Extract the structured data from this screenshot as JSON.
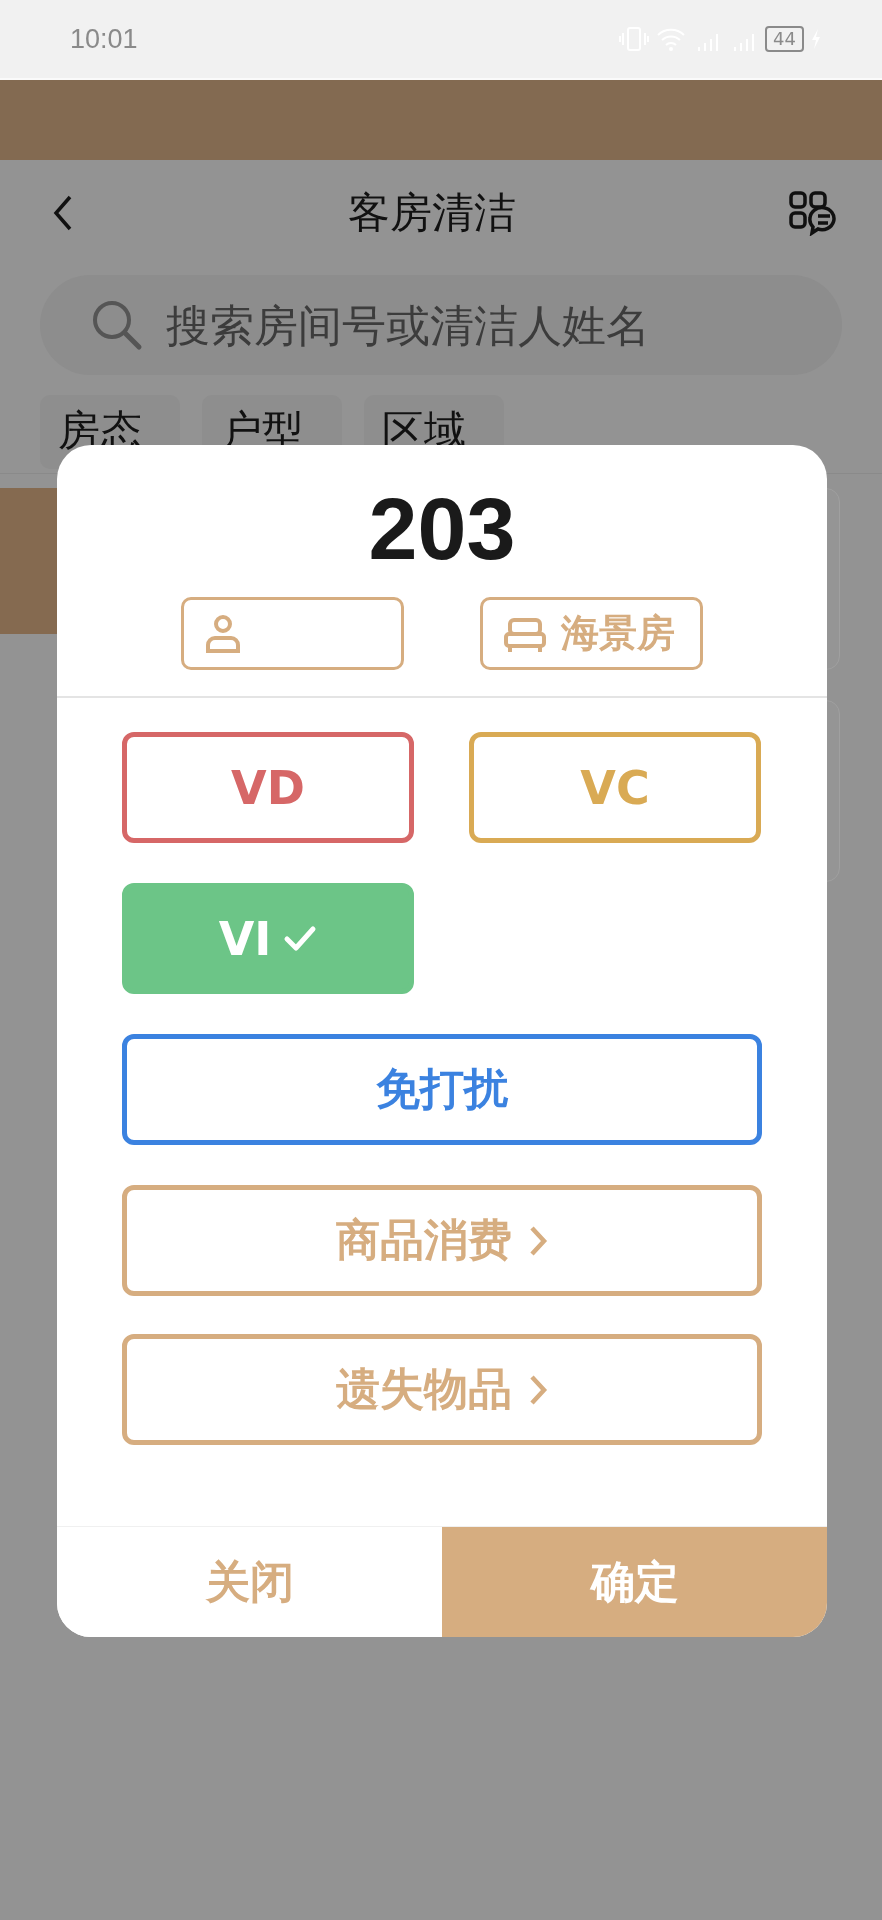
{
  "status_bar": {
    "time": "10:01",
    "battery": "44"
  },
  "header": {
    "title": "客房清洁"
  },
  "search": {
    "placeholder": "搜索房间号或清洁人姓名"
  },
  "filters": [
    {
      "label": "房态"
    },
    {
      "label": "户型"
    },
    {
      "label": "区域"
    }
  ],
  "dialog": {
    "room_number": "203",
    "room_type": "海景房",
    "statuses": [
      {
        "label": "VD",
        "color": "#d66767",
        "selected": false
      },
      {
        "label": "VC",
        "color": "#d9aa54",
        "selected": false
      },
      {
        "label": "VI",
        "color": "#6cc587",
        "selected": true
      }
    ],
    "do_not_disturb": {
      "label": "免打扰",
      "selected": false
    },
    "links": [
      {
        "label": "商品消费"
      },
      {
        "label": "遗失物品"
      }
    ],
    "buttons": [
      {
        "label": "关闭",
        "kind": "secondary"
      },
      {
        "label": "确定",
        "kind": "primary"
      }
    ]
  }
}
